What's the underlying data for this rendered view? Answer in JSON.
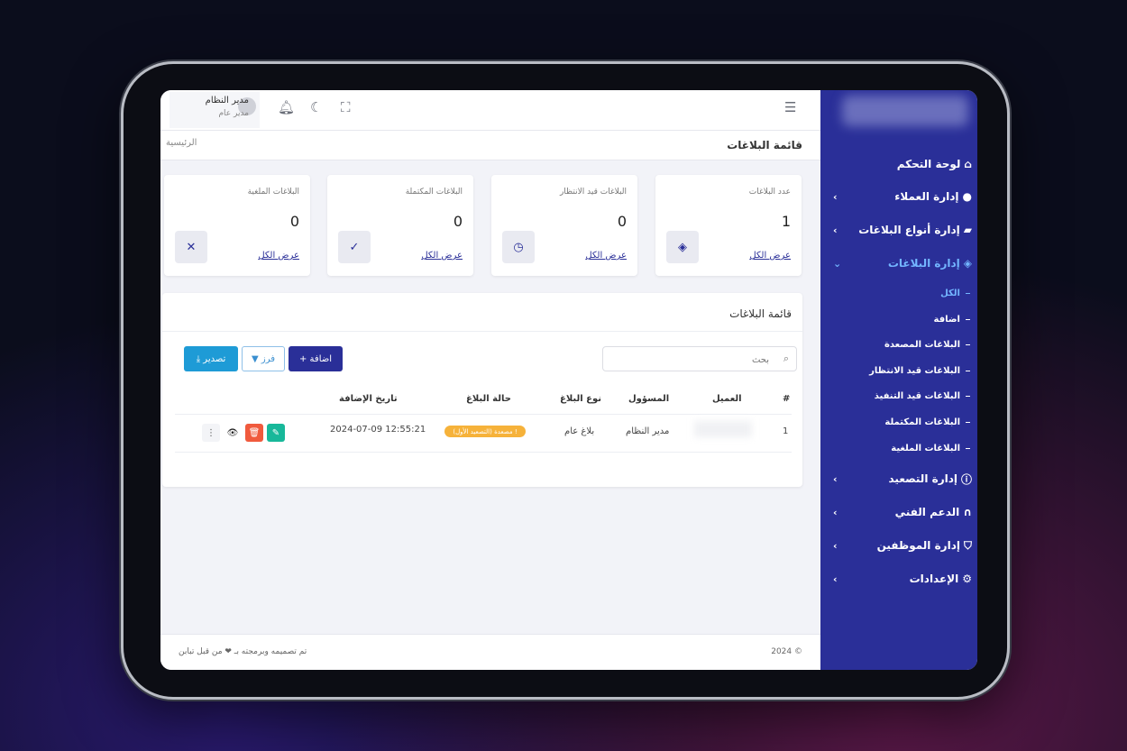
{
  "sidebar": {
    "items": [
      {
        "label": "لوحة التحكم",
        "icon": "home-icon",
        "chevron": ""
      },
      {
        "label": "إدارة العملاء",
        "icon": "user-icon",
        "chevron": "‹"
      },
      {
        "label": "إدارة أنواع البلاغات",
        "icon": "folder-icon",
        "chevron": "‹"
      },
      {
        "label": "إدارة البلاغات",
        "icon": "layers-icon",
        "chevron": "⌄"
      },
      {
        "label": "إدارة التصعيد",
        "icon": "info-icon",
        "chevron": "‹"
      },
      {
        "label": "الدعم الفني",
        "icon": "headset-icon",
        "chevron": "‹"
      },
      {
        "label": "إدارة الموظفين",
        "icon": "shield-user-icon",
        "chevron": "‹"
      },
      {
        "label": "الإعدادات",
        "icon": "gear-icon",
        "chevron": "‹"
      }
    ],
    "sub_items": [
      "الكل",
      "اضافة",
      "البلاغات المصعدة",
      "البلاغات قيد الانتظار",
      "البلاغات قيد التنفيذ",
      "البلاغات المكتملة",
      "البلاغات الملغية"
    ],
    "accent": "#2a2f98"
  },
  "topbar": {
    "user_name": "مدير النظام",
    "user_role": "مدير عام"
  },
  "page": {
    "title": "قائمة البلاغات",
    "breadcrumb": "الرئيسية"
  },
  "cards": [
    {
      "title": "عدد البلاغات",
      "value": "1",
      "link": "عرض الكل",
      "icon": "layers-icon",
      "glyph": "◈"
    },
    {
      "title": "البلاغات قيد الانتظار",
      "value": "0",
      "link": "عرض الكل",
      "icon": "clock-icon",
      "glyph": "◷"
    },
    {
      "title": "البلاغات المكتملة",
      "value": "0",
      "link": "عرض الكل",
      "icon": "check-icon",
      "glyph": "✓"
    },
    {
      "title": "البلاغات الملغية",
      "value": "0",
      "link": "عرض الكل",
      "icon": "close-icon",
      "glyph": "✕"
    }
  ],
  "list": {
    "title": "قائمة البلاغات",
    "search_placeholder": "بحث",
    "add_label": "+ اضافة",
    "sort_label": "▼ فرز",
    "export_label": "⤓ تصدير",
    "columns": {
      "num": "#",
      "client": "العميل",
      "owner": "المسؤول",
      "type": "نوع البلاغ",
      "status": "حالة البلاغ",
      "date": "تاريخ الإضافة"
    },
    "rows": [
      {
        "num": "1",
        "owner": "مدير النظام",
        "type": "بلاغ عام",
        "status": "مصعدة (التصعيد الأول) !",
        "date": "2024-07-09 12:55:21"
      }
    ],
    "badge_color": "#f6b23a"
  },
  "footer": {
    "copyright": "2024 ©",
    "credit": "تم تصميمه وبرمجته بـ ❤ من قبل تبابن"
  }
}
